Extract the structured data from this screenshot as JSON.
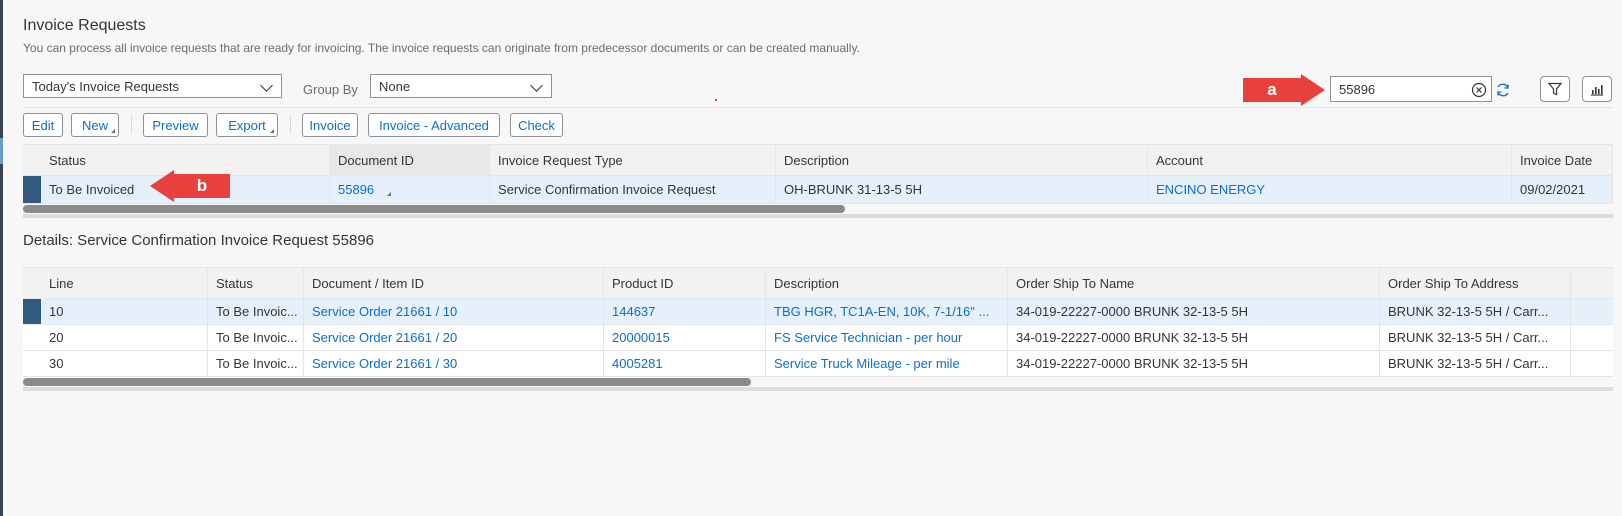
{
  "page": {
    "title": "Invoice Requests",
    "subtitle": "You can process all invoice requests that are ready for invoicing. The invoice requests can originate from predecessor documents or can be created manually."
  },
  "filters": {
    "view_select": "Today's Invoice Requests",
    "group_by_label": "Group By",
    "group_by_value": "None",
    "search_value": "55896"
  },
  "toolbar": {
    "edit": "Edit",
    "new": "New",
    "preview": "Preview",
    "export": "Export",
    "invoice": "Invoice",
    "invoice_advanced": "Invoice - Advanced",
    "check": "Check"
  },
  "requests_table": {
    "columns": [
      "Status",
      "Document ID",
      "Invoice Request Type",
      "Description",
      "Account",
      "Invoice Date"
    ],
    "rows": [
      {
        "status": "To Be Invoiced",
        "document_id": "55896",
        "type": "Service Confirmation Invoice Request",
        "description": "OH-BRUNK 31-13-5 5H",
        "account": "ENCINO ENERGY",
        "invoice_date": "09/02/2021"
      }
    ]
  },
  "details": {
    "title": "Details: Service Confirmation Invoice Request 55896",
    "columns": [
      "Line",
      "Status",
      "Document / Item ID",
      "Product ID",
      "Description",
      "Order Ship To Name",
      "Order Ship To Address"
    ],
    "rows": [
      {
        "line": "10",
        "status": "To Be Invoic...",
        "item": "Service Order 21661 / 10",
        "product": "144637",
        "description": "TBG HGR, TC1A-EN, 10K, 7-1/16\" ...",
        "ship_name": "34-019-22227-0000 BRUNK 32-13-5 5H",
        "ship_address": "BRUNK 32-13-5 5H / Carr..."
      },
      {
        "line": "20",
        "status": "To Be Invoic...",
        "item": "Service Order 21661 / 20",
        "product": "20000015",
        "description": "FS Service Technician - per hour",
        "ship_name": "34-019-22227-0000 BRUNK 32-13-5 5H",
        "ship_address": "BRUNK 32-13-5 5H / Carr..."
      },
      {
        "line": "30",
        "status": "To Be Invoic...",
        "item": "Service Order 21661 / 30",
        "product": "4005281",
        "description": "Service Truck Mileage - per mile",
        "ship_name": "34-019-22227-0000 BRUNK 32-13-5 5H",
        "ship_address": "BRUNK 32-13-5 5H / Carr..."
      }
    ]
  },
  "annotations": {
    "a": "a",
    "b": "b",
    "color": "#e8403d"
  },
  "colors": {
    "link": "#0a6ed1",
    "selection": "#32597f",
    "selected_row": "#e5f0fa"
  }
}
